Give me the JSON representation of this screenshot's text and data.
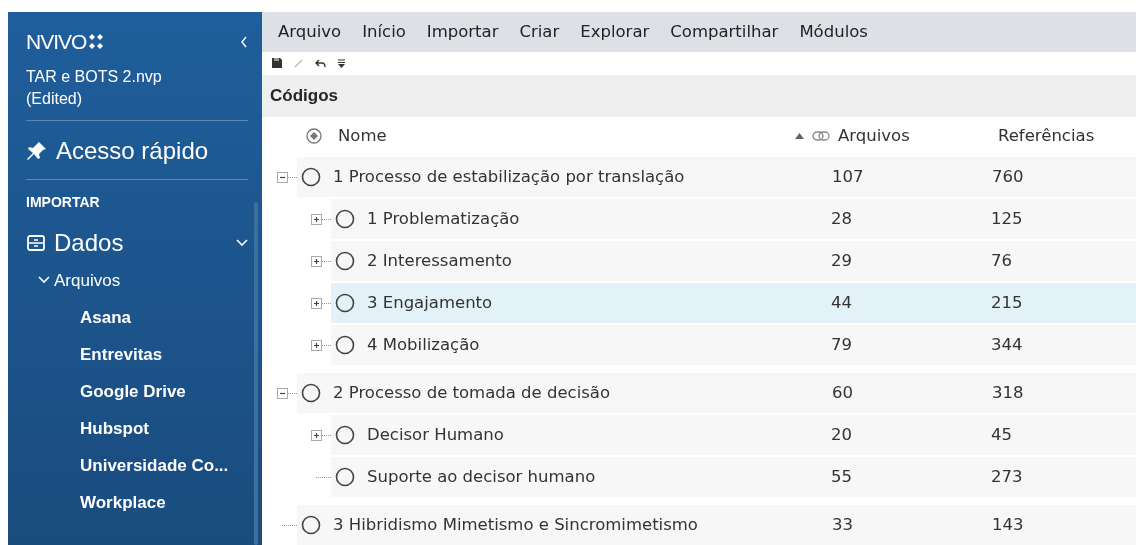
{
  "sidebar": {
    "logo": "NVIVO",
    "project": "TAR e BOTS 2.nvp (Edited)",
    "quick_access": "Acesso rápido",
    "section_label": "IMPORTAR",
    "groups": [
      {
        "label": "Dados",
        "expanded": true,
        "children": [
          {
            "label": "Arquivos",
            "expanded": true,
            "children": [
              {
                "label": "Asana"
              },
              {
                "label": "Entrevitas"
              },
              {
                "label": "Google Drive"
              },
              {
                "label": "Hubspot"
              },
              {
                "label": "Universidade Co..."
              },
              {
                "label": "Workplace"
              }
            ]
          }
        ]
      }
    ]
  },
  "ribbon_tabs": [
    {
      "label": "Arquivo",
      "selected": false
    },
    {
      "label": "Início",
      "selected": false
    },
    {
      "label": "Importar",
      "selected": false
    },
    {
      "label": "Criar",
      "selected": false
    },
    {
      "label": "Explorar",
      "selected": false
    },
    {
      "label": "Compartilhar",
      "selected": false
    },
    {
      "label": "Módulos",
      "selected": false
    }
  ],
  "panel_title": "Códigos",
  "table": {
    "columns": [
      "Nome",
      "Arquivos",
      "Referências"
    ],
    "rows": [
      {
        "name": "1 Processo de estabilização por translação",
        "files": "107",
        "refs": "760",
        "expanded": true,
        "selected": false,
        "children": [
          {
            "name": "1 Problematização",
            "files": "28",
            "refs": "125",
            "expanded": false,
            "selected": false
          },
          {
            "name": "2 Interessamento",
            "files": "29",
            "refs": "76",
            "expanded": false,
            "selected": false
          },
          {
            "name": "3 Engajamento",
            "files": "44",
            "refs": "215",
            "expanded": false,
            "selected": true
          },
          {
            "name": "4 Mobilização",
            "files": "79",
            "refs": "344",
            "expanded": false,
            "selected": false
          }
        ]
      },
      {
        "name": "2 Processo de tomada de decisão",
        "files": "60",
        "refs": "318",
        "expanded": true,
        "selected": false,
        "children": [
          {
            "name": "Decisor Humano",
            "files": "20",
            "refs": "45",
            "expanded": false,
            "selected": false
          },
          {
            "name": "Suporte ao decisor humano",
            "files": "55",
            "refs": "273",
            "selected": false
          }
        ]
      },
      {
        "name": "3 Hibridismo Mimetismo e Sincromimetismo",
        "files": "33",
        "refs": "143",
        "selected": false
      }
    ]
  }
}
